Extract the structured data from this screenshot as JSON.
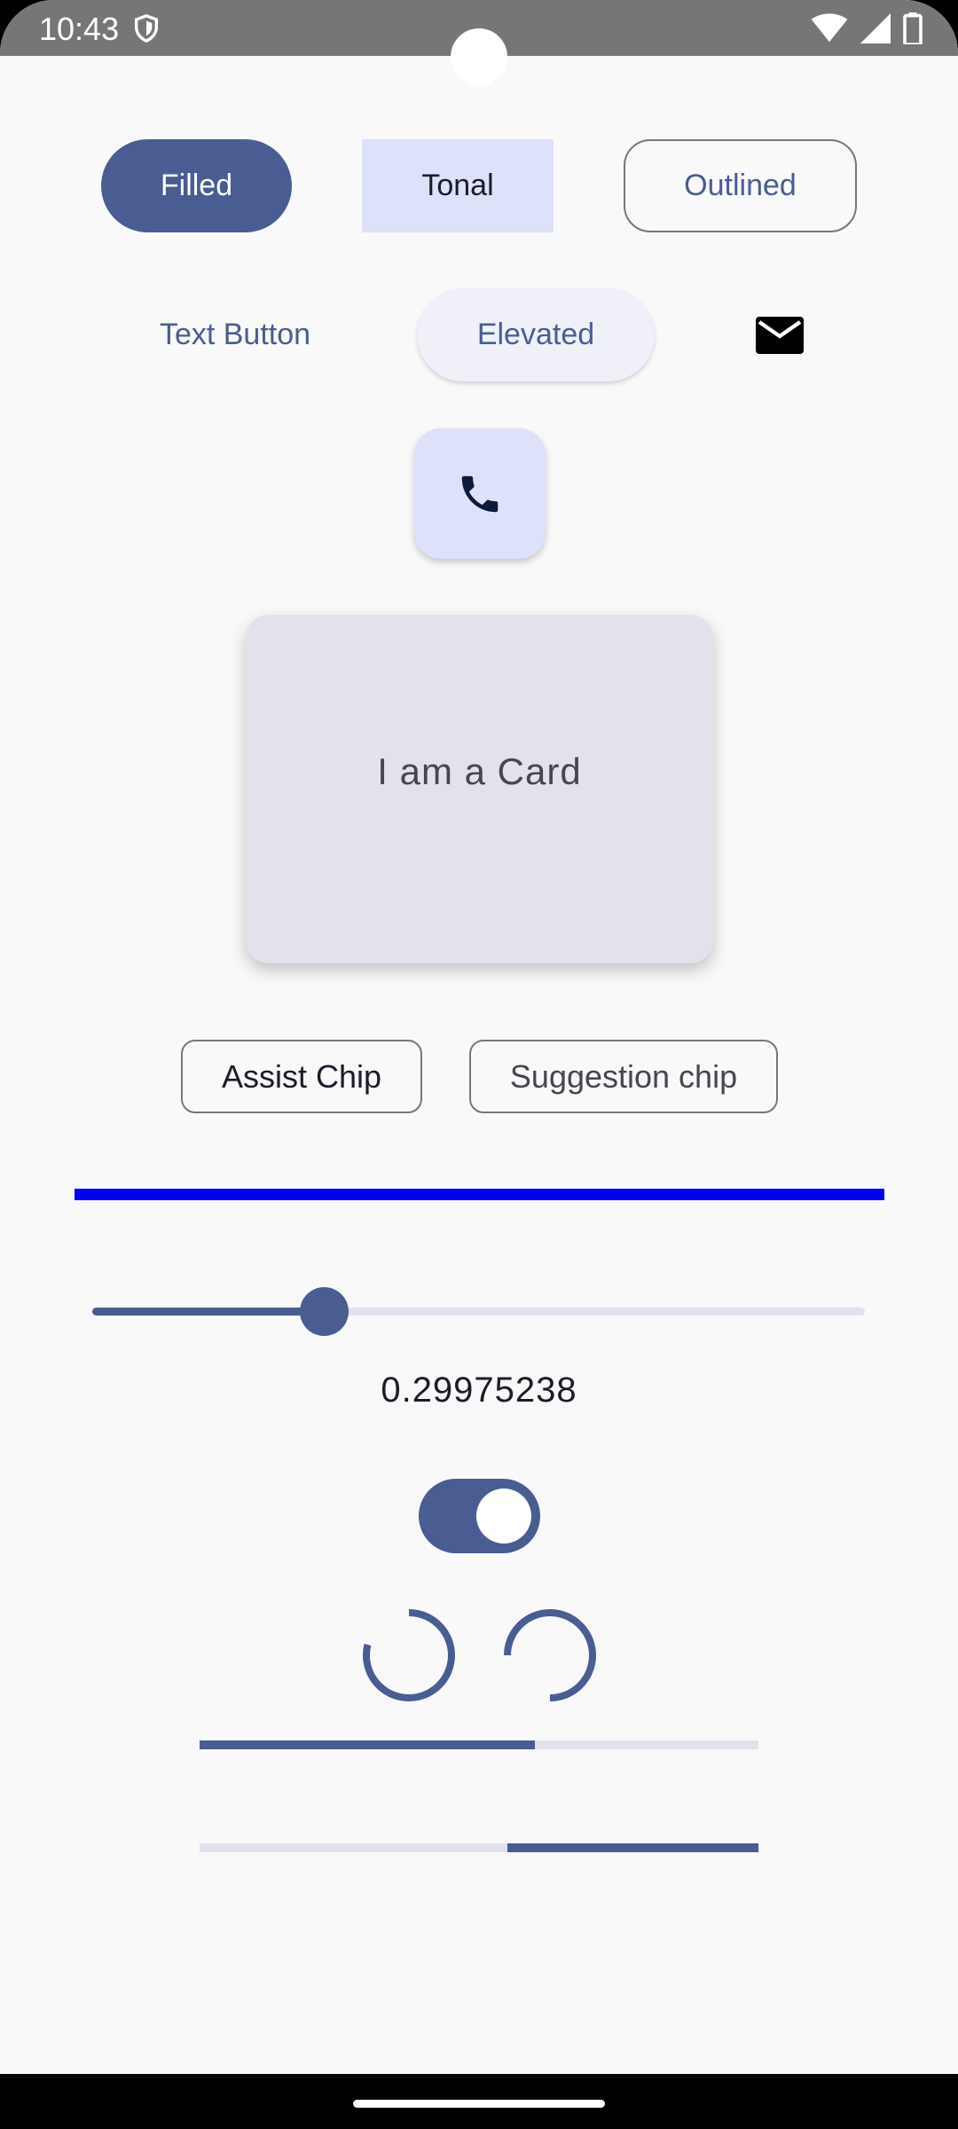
{
  "status_bar": {
    "time": "10:43",
    "icons": [
      "shield-icon",
      "wifi-icon",
      "signal-icon",
      "battery-icon"
    ]
  },
  "buttons": {
    "filled_label": "Filled",
    "tonal_label": "Tonal",
    "outlined_label": "Outlined",
    "text_label": "Text Button",
    "elevated_label": "Elevated",
    "icon_button": "mail-icon",
    "fab_icon": "phone-icon"
  },
  "card": {
    "text": "I am a Card"
  },
  "chips": {
    "assist_label": "Assist Chip",
    "suggestion_label": "Suggestion chip"
  },
  "slider": {
    "value": 0.29975238,
    "value_text": "0.29975238"
  },
  "switch": {
    "checked": true
  },
  "progress": {
    "linear_1_fraction": 0.6,
    "linear_2_start": 0.55,
    "linear_2_end": 1.0
  },
  "colors": {
    "primary": "#495d92",
    "secondary_container": "#dde1f9",
    "surface": "#f9f9f9",
    "divider": "#0000ff",
    "outline": "#75777f"
  }
}
